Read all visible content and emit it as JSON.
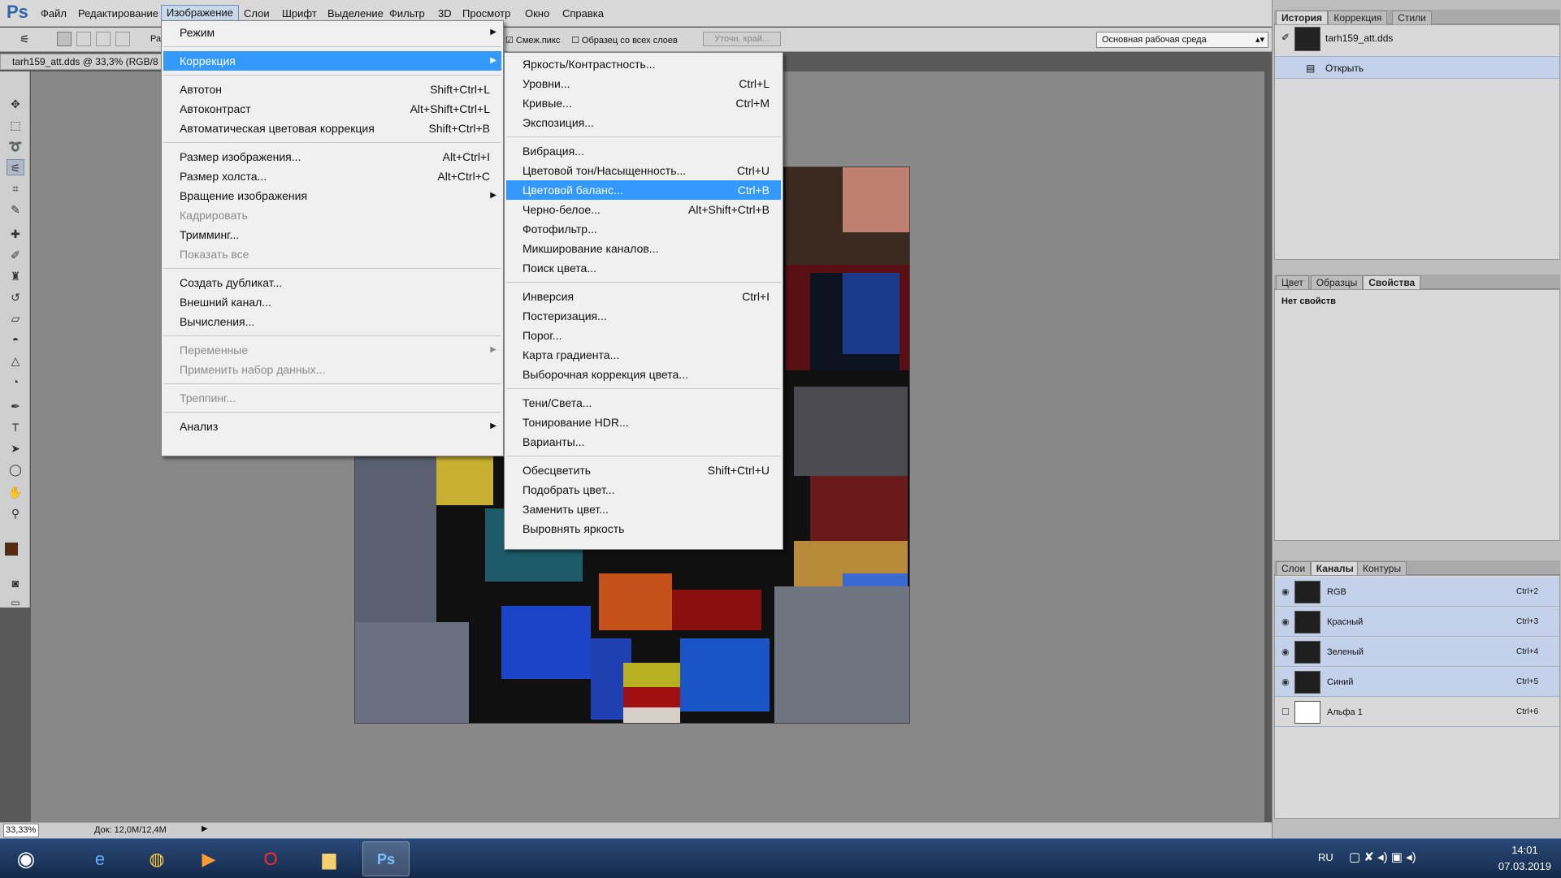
{
  "app": {
    "logo": "Ps"
  },
  "menubar": {
    "items": [
      "Файл",
      "Редактирование",
      "Изображение",
      "Слои",
      "Шрифт",
      "Выделение",
      "Фильтр",
      "3D",
      "Просмотр",
      "Окно",
      "Справка"
    ]
  },
  "options": {
    "contiguous": "Смеж.пикс",
    "sample_all": "Образец со всех слоев",
    "refine": "Уточн. край...",
    "workspace": "Основная рабочая среда",
    "small_label": "Ра"
  },
  "document": {
    "tab": "tarh159_att.dds @ 33,3% (RGB/8"
  },
  "status": {
    "zoom": "33,33%",
    "doc": "Док: 12,0M/12,4M"
  },
  "image_menu": [
    {
      "label": "Режим",
      "arrow": true
    },
    {
      "sep": true
    },
    {
      "label": "Коррекция",
      "arrow": true,
      "hl": true
    },
    {
      "sep": true
    },
    {
      "label": "Автотон",
      "key": "Shift+Ctrl+L"
    },
    {
      "label": "Автоконтраст",
      "key": "Alt+Shift+Ctrl+L"
    },
    {
      "label": "Автоматическая цветовая коррекция",
      "key": "Shift+Ctrl+B"
    },
    {
      "sep": true
    },
    {
      "label": "Размер изображения...",
      "key": "Alt+Ctrl+I"
    },
    {
      "label": "Размер холста...",
      "key": "Alt+Ctrl+C"
    },
    {
      "label": "Вращение изображения",
      "arrow": true
    },
    {
      "label": "Кадрировать",
      "dis": true
    },
    {
      "label": "Тримминг..."
    },
    {
      "label": "Показать все",
      "dis": true
    },
    {
      "sep": true
    },
    {
      "label": "Создать дубликат..."
    },
    {
      "label": "Внешний канал..."
    },
    {
      "label": "Вычисления..."
    },
    {
      "sep": true
    },
    {
      "label": "Переменные",
      "arrow": true,
      "dis": true
    },
    {
      "label": "Применить набор данных...",
      "dis": true
    },
    {
      "sep": true
    },
    {
      "label": "Треппинг...",
      "dis": true
    },
    {
      "sep": true
    },
    {
      "label": "Анализ",
      "arrow": true
    }
  ],
  "adjust_menu": [
    {
      "label": "Яркость/Контрастность..."
    },
    {
      "label": "Уровни...",
      "key": "Ctrl+L"
    },
    {
      "label": "Кривые...",
      "key": "Ctrl+M"
    },
    {
      "label": "Экспозиция..."
    },
    {
      "sep": true
    },
    {
      "label": "Вибрация..."
    },
    {
      "label": "Цветовой тон/Насыщенность...",
      "key": "Ctrl+U"
    },
    {
      "label": "Цветовой баланс...",
      "key": "Ctrl+B",
      "hl": true
    },
    {
      "label": "Черно-белое...",
      "key": "Alt+Shift+Ctrl+B"
    },
    {
      "label": "Фотофильтр..."
    },
    {
      "label": "Микширование каналов..."
    },
    {
      "label": "Поиск цвета..."
    },
    {
      "sep": true
    },
    {
      "label": "Инверсия",
      "key": "Ctrl+I"
    },
    {
      "label": "Постеризация..."
    },
    {
      "label": "Порог..."
    },
    {
      "label": "Карта градиента..."
    },
    {
      "label": "Выборочная коррекция цвета..."
    },
    {
      "sep": true
    },
    {
      "label": "Тени/Света..."
    },
    {
      "label": "Тонирование HDR..."
    },
    {
      "label": "Варианты..."
    },
    {
      "sep": true
    },
    {
      "label": "Обесцветить",
      "key": "Shift+Ctrl+U"
    },
    {
      "label": "Подобрать цвет..."
    },
    {
      "label": "Заменить цвет..."
    },
    {
      "label": "Выровнять яркость"
    }
  ],
  "history_panel": {
    "tabs": [
      "История",
      "Коррекция",
      "Стили"
    ],
    "snapshot": "tarh159_att.dds",
    "step": "Открыть"
  },
  "props_panel": {
    "tabs": [
      "Цвет",
      "Образцы",
      "Свойства"
    ],
    "empty": "Нет свойств"
  },
  "layers_panel": {
    "tabs": [
      "Слои",
      "Каналы",
      "Контуры"
    ],
    "channels": [
      {
        "name": "RGB",
        "key": "Ctrl+2"
      },
      {
        "name": "Красный",
        "key": "Ctrl+3"
      },
      {
        "name": "Зеленый",
        "key": "Ctrl+4"
      },
      {
        "name": "Синий",
        "key": "Ctrl+5"
      },
      {
        "name": "Альфа 1",
        "key": "Ctrl+6"
      }
    ]
  },
  "taskbar": {
    "lang": "RU",
    "time": "14:01",
    "date": "07.03.2019"
  },
  "colors": {
    "highlight": "#3399ff",
    "fg_swatch": "#5a2a10",
    "bg_swatch": "#000000"
  }
}
